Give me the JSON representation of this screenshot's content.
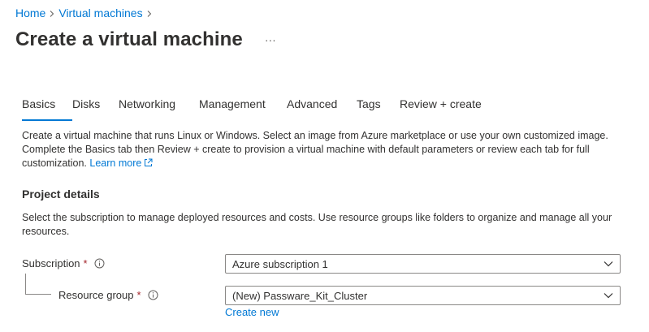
{
  "breadcrumb": {
    "items": [
      {
        "label": "Home"
      },
      {
        "label": "Virtual machines"
      }
    ]
  },
  "header": {
    "title": "Create a virtual machine",
    "more_label": "···"
  },
  "tabs": [
    {
      "label": "Basics",
      "active": true
    },
    {
      "label": "Disks",
      "active": false
    },
    {
      "label": "Networking",
      "active": false
    },
    {
      "label": "Management",
      "active": false
    },
    {
      "label": "Advanced",
      "active": false
    },
    {
      "label": "Tags",
      "active": false
    },
    {
      "label": "Review + create",
      "active": false
    }
  ],
  "intro": {
    "text": "Create a virtual machine that runs Linux or Windows. Select an image from Azure marketplace or use your own customized image. Complete the Basics tab then Review + create to provision a virtual machine with default parameters or review each tab for full customization.",
    "link": "Learn more"
  },
  "project_details": {
    "title": "Project details",
    "description": "Select the subscription to manage deployed resources and costs. Use resource groups like folders to organize and manage all your resources.",
    "subscription": {
      "label": "Subscription",
      "required_mark": "*",
      "value": "Azure subscription 1"
    },
    "resource_group": {
      "label": "Resource group",
      "required_mark": "*",
      "value": "(New) Passware_Kit_Cluster",
      "create_link": "Create new"
    }
  },
  "colors": {
    "accent": "#0078d4",
    "text": "#323130",
    "required": "#a4262c",
    "border": "#8a8886"
  }
}
